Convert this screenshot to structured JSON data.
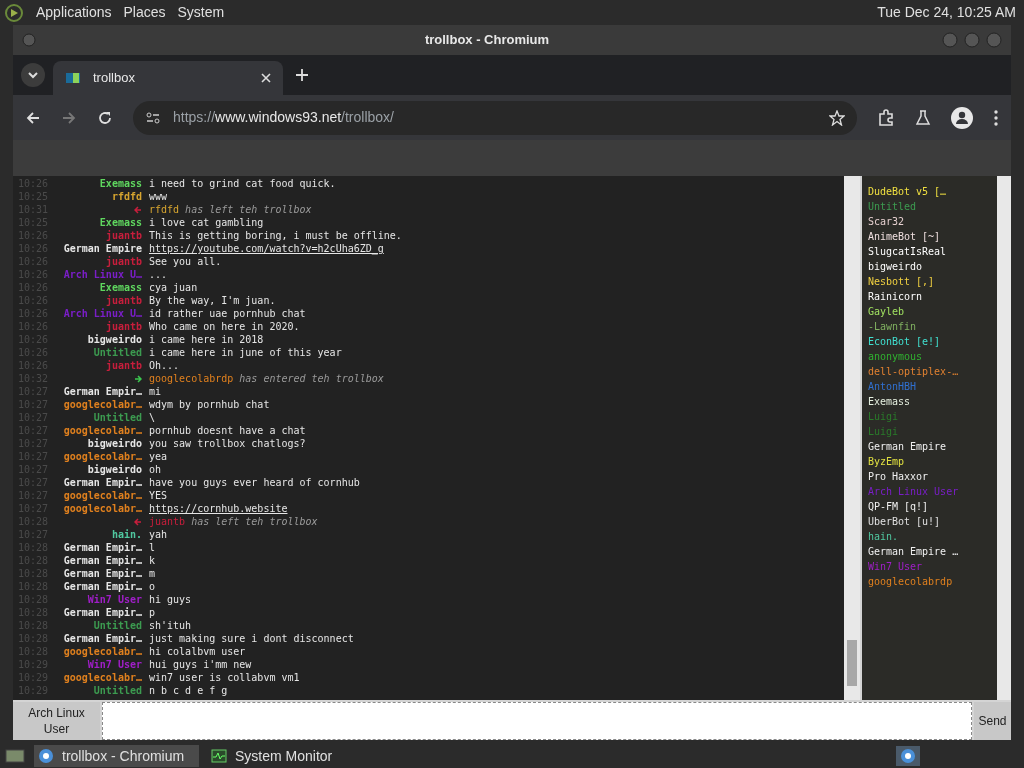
{
  "top_panel": {
    "menus": [
      "Applications",
      "Places",
      "System"
    ],
    "clock": "Tue Dec 24, 10:25 AM"
  },
  "window": {
    "title": "trollbox - Chromium"
  },
  "tabs": [
    {
      "label": "trollbox",
      "selected": true
    }
  ],
  "address_bar": {
    "scheme": "https://",
    "host": "www.windows93.net",
    "path": "/trollbox/"
  },
  "messages": [
    {
      "kind": "message",
      "time": "10:26",
      "nick": "Exemass",
      "color": "#5fd75f",
      "text": "i need to grind cat food quick."
    },
    {
      "kind": "message",
      "time": "10:25",
      "nick": "rfdfd",
      "color": "#d7a52f",
      "text": "www"
    },
    {
      "kind": "left",
      "time": "10:31",
      "nick": "rfdfd",
      "color": "#d7a52f",
      "text": "has left teh trollbox"
    },
    {
      "kind": "message",
      "time": "10:25",
      "nick": "Exemass",
      "color": "#5fd75f",
      "text": "i love cat gambling"
    },
    {
      "kind": "message",
      "time": "10:26",
      "nick": "juantb",
      "color": "#c81e3c",
      "text": "This is getting boring, i must be offline."
    },
    {
      "kind": "link",
      "time": "10:26",
      "nick": "German Empire",
      "color": "#e6e6e6",
      "text": "https://youtube.com/watch?v=h2cUha6ZD_g"
    },
    {
      "kind": "message",
      "time": "10:26",
      "nick": "juantb",
      "color": "#c81e3c",
      "text": "See you all."
    },
    {
      "kind": "message",
      "time": "10:26",
      "nick": "Arch Linux U…",
      "color": "#7a1ec8",
      "text": "..."
    },
    {
      "kind": "message",
      "time": "10:26",
      "nick": "Exemass",
      "color": "#5fd75f",
      "text": "cya juan"
    },
    {
      "kind": "message",
      "time": "10:26",
      "nick": "juantb",
      "color": "#c81e3c",
      "text": "By the way, I'm juan."
    },
    {
      "kind": "message",
      "time": "10:26",
      "nick": "Arch Linux U…",
      "color": "#7a1ec8",
      "text": "id rather uae pornhub chat"
    },
    {
      "kind": "message",
      "time": "10:26",
      "nick": "juantb",
      "color": "#c81e3c",
      "text": "Who came on here in 2020."
    },
    {
      "kind": "message",
      "time": "10:26",
      "nick": "bigweirdo",
      "color": "#e6e6e6",
      "text": "i came here in 2018"
    },
    {
      "kind": "message",
      "time": "10:26",
      "nick": "Untitled",
      "color": "#3c9b50",
      "text": "i came here in june of this year"
    },
    {
      "kind": "message",
      "time": "10:26",
      "nick": "juantb",
      "color": "#c81e3c",
      "text": "Oh..."
    },
    {
      "kind": "entered",
      "time": "10:32",
      "nick": "googlecolabrdp",
      "color": "#e0801e",
      "text": "has entered teh trollbox"
    },
    {
      "kind": "message",
      "time": "10:27",
      "nick": "German Empir…",
      "color": "#e6e6e6",
      "text": "mi"
    },
    {
      "kind": "message",
      "time": "10:27",
      "nick": "googlecolabr…",
      "color": "#e0801e",
      "text": "wdym by pornhub chat"
    },
    {
      "kind": "message",
      "time": "10:27",
      "nick": "Untitled",
      "color": "#3c9b50",
      "text": "\\"
    },
    {
      "kind": "message",
      "time": "10:27",
      "nick": "googlecolabr…",
      "color": "#e0801e",
      "text": "pornhub doesnt have a chat"
    },
    {
      "kind": "message",
      "time": "10:27",
      "nick": "bigweirdo",
      "color": "#e6e6e6",
      "text": "you saw trollbox chatlogs?"
    },
    {
      "kind": "message",
      "time": "10:27",
      "nick": "googlecolabr…",
      "color": "#e0801e",
      "text": "yea"
    },
    {
      "kind": "message",
      "time": "10:27",
      "nick": "bigweirdo",
      "color": "#e6e6e6",
      "text": "oh"
    },
    {
      "kind": "message",
      "time": "10:27",
      "nick": "German Empir…",
      "color": "#e6e6e6",
      "text": "have you guys ever heard of cornhub"
    },
    {
      "kind": "message",
      "time": "10:27",
      "nick": "googlecolabr…",
      "color": "#e0801e",
      "text": "YES"
    },
    {
      "kind": "link",
      "time": "10:27",
      "nick": "googlecolabr…",
      "color": "#e0801e",
      "text": "https://cornhub.website"
    },
    {
      "kind": "left",
      "time": "10:28",
      "nick": "juantb",
      "color": "#c81e3c",
      "text": "has left teh trollbox"
    },
    {
      "kind": "message",
      "time": "10:27",
      "nick": "hain.",
      "color": "#50c8a0",
      "text": "yah"
    },
    {
      "kind": "message",
      "time": "10:28",
      "nick": "German Empir…",
      "color": "#e6e6e6",
      "text": "l"
    },
    {
      "kind": "message",
      "time": "10:28",
      "nick": "German Empir…",
      "color": "#e6e6e6",
      "text": "k"
    },
    {
      "kind": "message",
      "time": "10:28",
      "nick": "German Empir…",
      "color": "#e6e6e6",
      "text": "m"
    },
    {
      "kind": "message",
      "time": "10:28",
      "nick": "German Empir…",
      "color": "#e6e6e6",
      "text": "o"
    },
    {
      "kind": "message",
      "time": "10:28",
      "nick": "Win7 User",
      "color": "#a01ec8",
      "text": "hi guys"
    },
    {
      "kind": "message",
      "time": "10:28",
      "nick": "German Empir…",
      "color": "#e6e6e6",
      "text": "p"
    },
    {
      "kind": "message",
      "time": "10:28",
      "nick": "Untitled",
      "color": "#3c9b50",
      "text": "sh'ituh"
    },
    {
      "kind": "message",
      "time": "10:28",
      "nick": "German Empir…",
      "color": "#e6e6e6",
      "text": "just making sure i dont disconnect"
    },
    {
      "kind": "message",
      "time": "10:28",
      "nick": "googlecolabr…",
      "color": "#e0801e",
      "text": "hi colalbvm user"
    },
    {
      "kind": "message",
      "time": "10:29",
      "nick": "Win7 User",
      "color": "#a01ec8",
      "text": "hui guys i'mm new"
    },
    {
      "kind": "message",
      "time": "10:29",
      "nick": "googlecolabr…",
      "color": "#e0801e",
      "text": "win7 user is collabvm vm1"
    },
    {
      "kind": "message",
      "time": "10:29",
      "nick": "Untitled",
      "color": "#3c9b50",
      "text": "n b c d e f g"
    }
  ],
  "users": [
    {
      "name": "DudeBot  v5 […",
      "color": "#f0e040"
    },
    {
      "name": "Untitled",
      "color": "#3c9b50"
    },
    {
      "name": "Scar32",
      "color": "#e6d0d0"
    },
    {
      "name": "AnimeBot  [~]",
      "color": "#f0e0e0"
    },
    {
      "name": "SlugcatIsReal",
      "color": "#ffffff"
    },
    {
      "name": "bigweirdo",
      "color": "#ffffff"
    },
    {
      "name": "Nesbott [,]",
      "color": "#f0d040"
    },
    {
      "name": "Rainicorn",
      "color": "#ffffff"
    },
    {
      "name": "Gayleb",
      "color": "#a0e060"
    },
    {
      "name": "-Lawnfin",
      "color": "#80b060"
    },
    {
      "name": "EconBot [e!]",
      "color": "#40e0d0"
    },
    {
      "name": "anonymous",
      "color": "#30b030"
    },
    {
      "name": "dell-optiplex-…",
      "color": "#e08030"
    },
    {
      "name": "AntonHBH",
      "color": "#3070d0"
    },
    {
      "name": "Exemass",
      "color": "#e6f0e0"
    },
    {
      "name": "Luigi",
      "color": "#2a7a2a"
    },
    {
      "name": "Luigi",
      "color": "#2a7a2a"
    },
    {
      "name": "German Empire",
      "color": "#f0f0f0"
    },
    {
      "name": "ByzEmp",
      "color": "#e0e040"
    },
    {
      "name": "Pro Haxxor",
      "color": "#f0f0f0"
    },
    {
      "name": "Arch Linux User",
      "color": "#7a1ec8"
    },
    {
      "name": "QP-FM [q!]",
      "color": "#f0f0f0"
    },
    {
      "name": "UberBot [u!]",
      "color": "#e0e0e0"
    },
    {
      "name": "hain.",
      "color": "#50c8a0"
    },
    {
      "name": "German Empire …",
      "color": "#f0f0f0"
    },
    {
      "name": "Win7 User",
      "color": "#a01ec8"
    },
    {
      "name": "googlecolabrdp",
      "color": "#e0801e"
    }
  ],
  "input": {
    "nick": "Arch Linux User",
    "send": "Send"
  },
  "taskbar": [
    {
      "label": "trollbox - Chromium",
      "selected": true
    },
    {
      "label": "System Monitor",
      "selected": false
    }
  ]
}
